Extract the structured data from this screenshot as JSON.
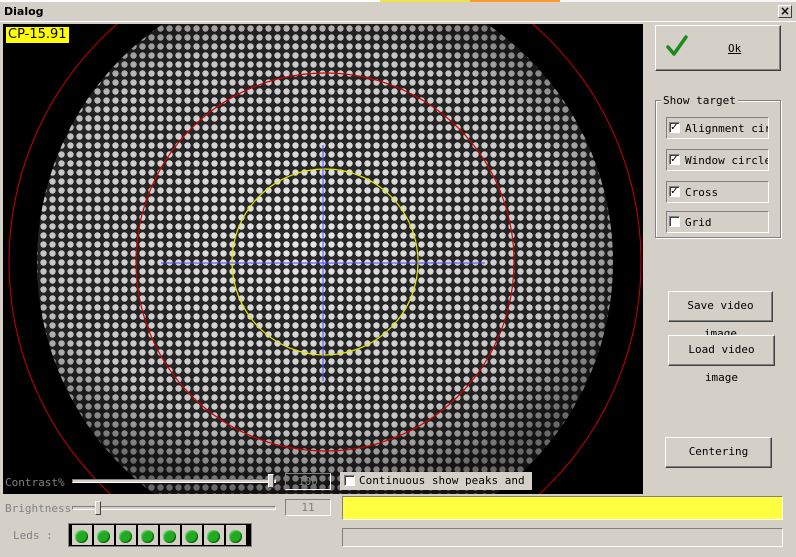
{
  "window": {
    "title": "Dialog",
    "close_glyph": "×"
  },
  "video": {
    "overlay_label": "CP-15.91"
  },
  "ok_button": {
    "label": "Ok",
    "icon": "green-check-icon"
  },
  "show_target": {
    "legend": "Show target",
    "options": [
      {
        "label": "Alignment circle",
        "checked": true
      },
      {
        "label": "Window circle",
        "checked": true
      },
      {
        "label": "Cross",
        "checked": true
      },
      {
        "label": "Grid",
        "checked": false
      }
    ]
  },
  "buttons": {
    "save_video": "Save video image",
    "load_video": "Load video image",
    "centering": "Centering"
  },
  "contrast": {
    "label": "Contrast%",
    "value": "100",
    "level": 1.0
  },
  "brightness": {
    "label": "Brightness",
    "value": "11",
    "level": 0.11
  },
  "continuous": {
    "label": "Continuous show peaks and periods",
    "checked": false
  },
  "leds": {
    "label": "Leds :",
    "count": 8,
    "color": "#22aa22"
  },
  "colors": {
    "status_yellow": "#ffff40",
    "alignment_circle": "#cc0000",
    "window_circle": "#e6e600",
    "cross": "#4040ff"
  }
}
